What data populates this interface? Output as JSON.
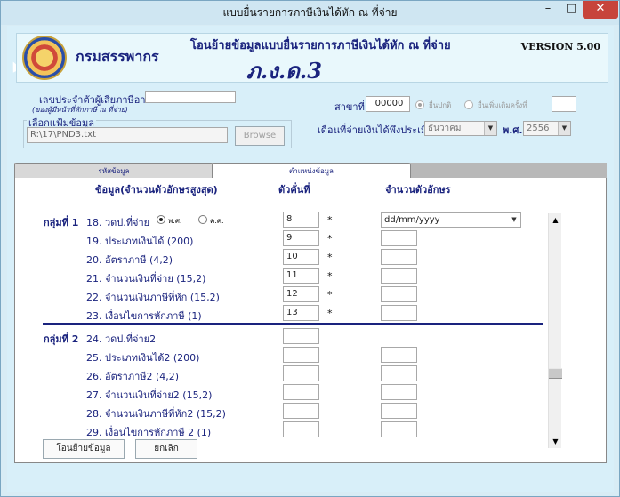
{
  "window": {
    "title": "แบบยื่นรายการภาษีเงินได้หัก ณ ที่จ่าย",
    "minimize_glyph": "–",
    "maximize_glyph": "□",
    "close_glyph": "✕"
  },
  "header": {
    "department": "กรมสรรพากร",
    "title": "โอนย้ายข้อมูลแบบยื่นรายการภาษีเงินได้หัก ณ ที่จ่าย",
    "form_code": "ภ.ง.ด.3",
    "version": "VERSION 5.00",
    "logo_icon": "revenue-department-seal"
  },
  "taxpayer": {
    "id_label": "เลขประจำตัวผู้เสียภาษีอากร",
    "id_hint": "(ของผู้มีหน้าที่หักภาษี ณ ที่จ่าย)",
    "id_value": "",
    "file_group_label": "เลือกแฟ้มข้อมูล",
    "file_path": "R:\\17\\PND3.txt",
    "browse_label": "Browse"
  },
  "branch": {
    "label": "สาขาที่",
    "value": "00000",
    "radio_normal": "ยื่นปกติ",
    "radio_additional": "ยื่นเพิ่มเติมครั้งที่",
    "additional_count": ""
  },
  "period": {
    "label": "เดือนที่จ่ายเงินได้พึงประเมิน",
    "month": "ธันวาคม",
    "year_label": "พ.ศ.",
    "year": "2556"
  },
  "tabs": [
    {
      "label": "รหัสข้อมูล"
    },
    {
      "label": "ตำแหน่งข้อมูล"
    }
  ],
  "columns": {
    "field": "ข้อมูล(จำนวนตัวอักษรสูงสุด)",
    "position": "ตัวคั่นที่",
    "length": "จำนวนตัวอักษร"
  },
  "groups": [
    {
      "label": "กลุ่มที่ 1",
      "fields": [
        {
          "label": "18. วดป.ที่จ่าย",
          "position": "8",
          "star": "*",
          "length": ""
        },
        {
          "label": "19. ประเภทเงินได้ (200)",
          "position": "9",
          "star": "*",
          "length": ""
        },
        {
          "label": "20. อัตราภาษี (4,2)",
          "position": "10",
          "star": "*",
          "length": ""
        },
        {
          "label": "21. จำนวนเงินที่จ่าย (15,2)",
          "position": "11",
          "star": "*",
          "length": ""
        },
        {
          "label": "22. จำนวนเงินภาษีที่หัก (15,2)",
          "position": "12",
          "star": "*",
          "length": ""
        },
        {
          "label": "23. เงื่อนไขการหักภาษี (1)",
          "position": "13",
          "star": "*",
          "length": ""
        }
      ],
      "date_era_be": "พ.ศ.",
      "date_era_ce": "ค.ศ.",
      "date_format": "dd/mm/yyyy"
    },
    {
      "label": "กลุ่มที่ 2",
      "fields": [
        {
          "label": "24. วดป.ที่จ่าย2",
          "position": "",
          "length": ""
        },
        {
          "label": "25. ประเภทเงินได้2 (200)",
          "position": "",
          "length": ""
        },
        {
          "label": "26. อัตราภาษี2 (4,2)",
          "position": "",
          "length": ""
        },
        {
          "label": "27. จำนวนเงินที่จ่าย2 (15,2)",
          "position": "",
          "length": ""
        },
        {
          "label": "28. จำนวนเงินภาษีที่หัก2 (15,2)",
          "position": "",
          "length": ""
        },
        {
          "label": "29. เงื่อนไขการหักภาษี 2 (1)",
          "position": "",
          "length": ""
        }
      ]
    }
  ],
  "scrollbar": {
    "up_glyph": "▲",
    "down_glyph": "▼"
  },
  "actions": {
    "transfer_label": "โอนย้ายข้อมูล",
    "cancel_label": "ยกเลิก"
  }
}
